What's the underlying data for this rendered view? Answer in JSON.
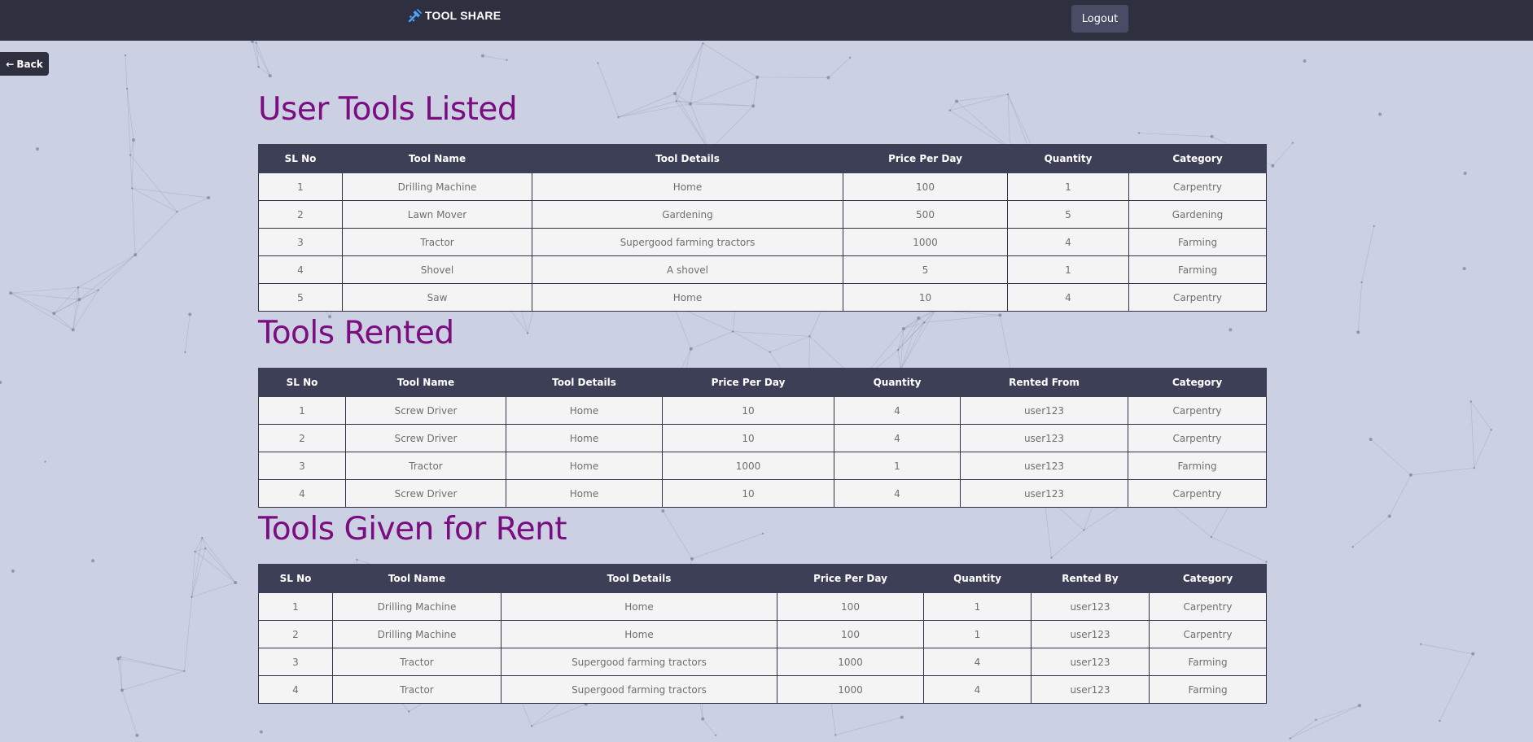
{
  "navbar": {
    "brand": "TOOL SHARE",
    "brand_icon": "tools-icon",
    "logout_label": "Logout"
  },
  "back_label": "Back",
  "back_icon": "arrow-left-icon",
  "colors": {
    "navbar_bg": "#2e2f3f",
    "page_bg": "#cbd0e3",
    "heading": "#7c0d80",
    "table_header_bg": "#3d3f57",
    "cell_bg": "#f4f4f4",
    "brand_icon": "#4aa3ff"
  },
  "sections": [
    {
      "title": "User Tools Listed",
      "headers": [
        "SL No",
        "Tool Name",
        "Tool Details",
        "Price Per Day",
        "Quantity",
        "Category"
      ],
      "rows": [
        [
          "1",
          "Drilling Machine",
          "Home",
          "100",
          "1",
          "Carpentry"
        ],
        [
          "2",
          "Lawn Mover",
          "Gardening",
          "500",
          "5",
          "Gardening"
        ],
        [
          "3",
          "Tractor",
          "Supergood farming tractors",
          "1000",
          "4",
          "Farming"
        ],
        [
          "4",
          "Shovel",
          "A shovel",
          "5",
          "1",
          "Farming"
        ],
        [
          "5",
          "Saw",
          "Home",
          "10",
          "4",
          "Carpentry"
        ]
      ]
    },
    {
      "title": "Tools Rented",
      "headers": [
        "SL No",
        "Tool Name",
        "Tool Details",
        "Price Per Day",
        "Quantity",
        "Rented From",
        "Category"
      ],
      "rows": [
        [
          "1",
          "Screw Driver",
          "Home",
          "10",
          "4",
          "user123",
          "Carpentry"
        ],
        [
          "2",
          "Screw Driver",
          "Home",
          "10",
          "4",
          "user123",
          "Carpentry"
        ],
        [
          "3",
          "Tractor",
          "Home",
          "1000",
          "1",
          "user123",
          "Farming"
        ],
        [
          "4",
          "Screw Driver",
          "Home",
          "10",
          "4",
          "user123",
          "Carpentry"
        ]
      ]
    },
    {
      "title": "Tools Given for Rent",
      "headers": [
        "SL No",
        "Tool Name",
        "Tool Details",
        "Price Per Day",
        "Quantity",
        "Rented By",
        "Category"
      ],
      "rows": [
        [
          "1",
          "Drilling Machine",
          "Home",
          "100",
          "1",
          "user123",
          "Carpentry"
        ],
        [
          "2",
          "Drilling Machine",
          "Home",
          "100",
          "1",
          "user123",
          "Carpentry"
        ],
        [
          "3",
          "Tractor",
          "Supergood farming tractors",
          "1000",
          "4",
          "user123",
          "Farming"
        ],
        [
          "4",
          "Tractor",
          "Supergood farming tractors",
          "1000",
          "4",
          "user123",
          "Farming"
        ]
      ]
    }
  ]
}
